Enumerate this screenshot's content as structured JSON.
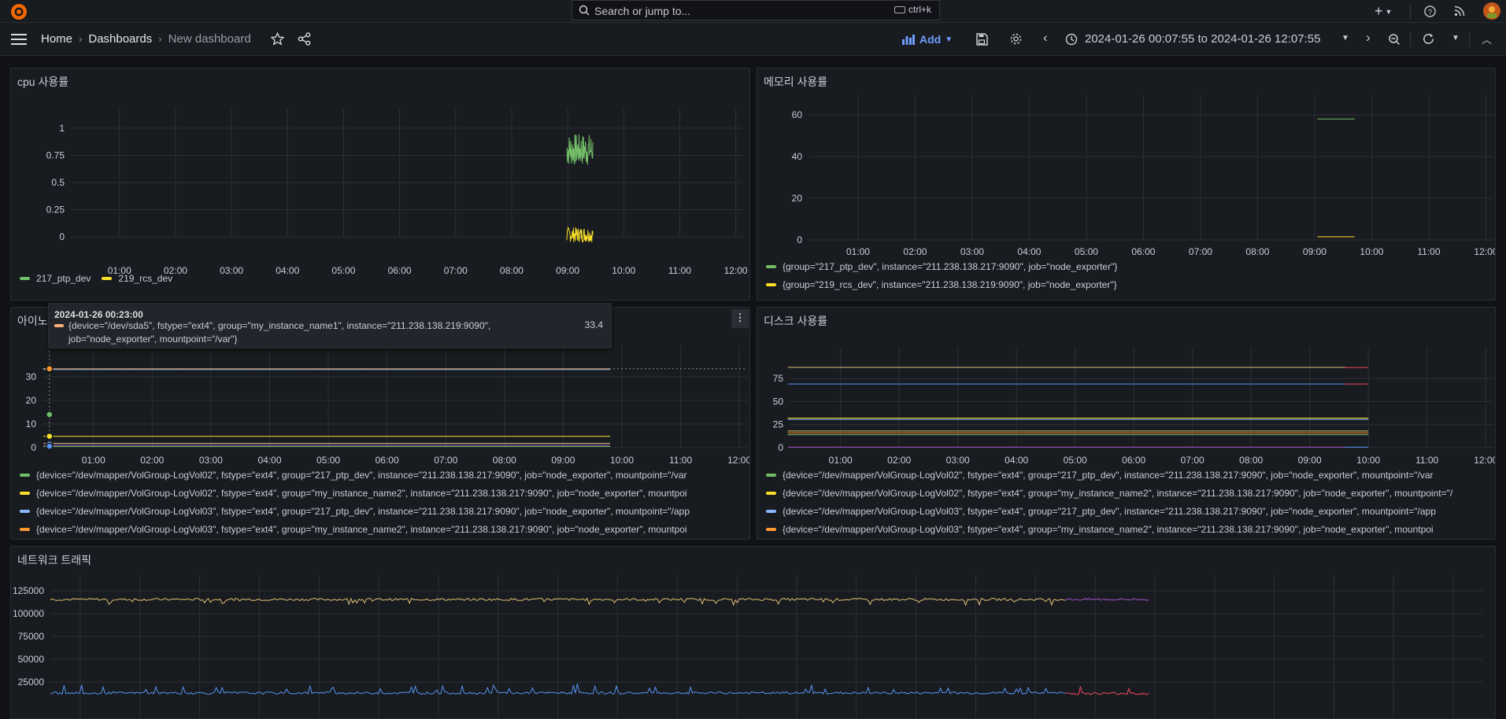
{
  "search": {
    "placeholder": "Search or jump to...",
    "shortcut": "ctrl+k"
  },
  "topbar": {
    "plus": "+",
    "icons": [
      "help-icon",
      "rss-icon",
      "avatar"
    ]
  },
  "breadcrumb": {
    "home": "Home",
    "dashboards": "Dashboards",
    "current": "New dashboard"
  },
  "toolbar": {
    "add_label": "Add",
    "time_range": "2024-01-26 00:07:55 to 2024-01-26 12:07:55"
  },
  "colors": {
    "green": "#73bf69",
    "yellow": "#fade2a",
    "blue": "#8ab8ff",
    "orange": "#ff9830",
    "purple": "#a352cc",
    "red": "#f2495c",
    "tan": "#e0c074",
    "steel": "#5794f2"
  },
  "time_ticks": [
    "01:00",
    "02:00",
    "03:00",
    "04:00",
    "05:00",
    "06:00",
    "07:00",
    "08:00",
    "09:00",
    "10:00",
    "11:00",
    "12:00"
  ],
  "panels": {
    "cpu": {
      "title": "cpu 사용률",
      "y_ticks": [
        "1",
        "0.75",
        "0.5",
        "0.25",
        "0"
      ],
      "legend": [
        "217_ptp_dev",
        "219_rcs_dev"
      ]
    },
    "memory": {
      "title": "메모리 사용률",
      "y_ticks": [
        "60",
        "40",
        "20",
        "0"
      ],
      "legend": [
        "{group=\"217_ptp_dev\", instance=\"211.238.138.217:9090\", job=\"node_exporter\"}",
        "{group=\"219_rcs_dev\", instance=\"211.238.138.219:9090\", job=\"node_exporter\"}"
      ]
    },
    "inode": {
      "title": "아이노드 사용률",
      "y_ticks": [
        "30",
        "20",
        "10",
        "0"
      ],
      "legend": [
        "{device=\"/dev/mapper/VolGroup-LogVol02\", fstype=\"ext4\", group=\"217_ptp_dev\", instance=\"211.238.138.217:9090\", job=\"node_exporter\", mountpoint=\"/var",
        "{device=\"/dev/mapper/VolGroup-LogVol02\", fstype=\"ext4\", group=\"my_instance_name2\", instance=\"211.238.138.217:9090\", job=\"node_exporter\", mountpoi",
        "{device=\"/dev/mapper/VolGroup-LogVol03\", fstype=\"ext4\", group=\"217_ptp_dev\", instance=\"211.238.138.217:9090\", job=\"node_exporter\", mountpoint=\"/app",
        "{device=\"/dev/mapper/VolGroup-LogVol03\", fstype=\"ext4\", group=\"my_instance_name2\", instance=\"211.238.138.217:9090\", job=\"node_exporter\", mountpoi"
      ],
      "tooltip": {
        "time": "2024-01-26 00:23:00",
        "label": "{device=\"/dev/sda5\", fstype=\"ext4\", group=\"my_instance_name1\", instance=\"211.238.138.219:9090\", job=\"node_exporter\", mountpoint=\"/var\"}",
        "value": "33.4"
      }
    },
    "disk": {
      "title": "디스크 사용률",
      "y_ticks": [
        "75",
        "50",
        "25",
        "0"
      ],
      "legend": [
        "{device=\"/dev/mapper/VolGroup-LogVol02\", fstype=\"ext4\", group=\"217_ptp_dev\", instance=\"211.238.138.217:9090\", job=\"node_exporter\", mountpoint=\"/var",
        "{device=\"/dev/mapper/VolGroup-LogVol02\", fstype=\"ext4\", group=\"my_instance_name2\", instance=\"211.238.138.217:9090\", job=\"node_exporter\", mountpoint=\"/",
        "{device=\"/dev/mapper/VolGroup-LogVol03\", fstype=\"ext4\", group=\"217_ptp_dev\", instance=\"211.238.138.217:9090\", job=\"node_exporter\", mountpoint=\"/app",
        "{device=\"/dev/mapper/VolGroup-LogVol03\", fstype=\"ext4\", group=\"my_instance_name2\", instance=\"211.238.138.217:9090\", job=\"node_exporter\", mountpoi"
      ]
    },
    "network": {
      "title": "네트워크 트래픽",
      "y_ticks": [
        "125000",
        "100000",
        "75000",
        "50000",
        "25000"
      ]
    }
  },
  "chart_data": [
    {
      "type": "line",
      "ylim": [
        0,
        1
      ],
      "x_range": [
        "00:07:55",
        "12:07:55"
      ],
      "series": [
        {
          "name": "217_ptp_dev",
          "x_range": [
            "08:58",
            "09:25"
          ],
          "approx_values": [
            0.7,
            0.9
          ]
        },
        {
          "name": "219_rcs_dev",
          "x_range": [
            "08:58",
            "09:25"
          ],
          "approx_values": [
            0,
            0.1
          ]
        }
      ]
    },
    {
      "type": "line",
      "ylim": [
        0,
        60
      ],
      "series": [
        {
          "name": "{group=\"217_ptp_dev\", instance=\"211.238.138.217:9090\", job=\"node_exporter\"}",
          "x_range": [
            "09:00",
            "09:35"
          ],
          "value": 58
        },
        {
          "name": "{group=\"219_rcs_dev\", instance=\"211.238.138.219:9090\", job=\"node_exporter\"}",
          "x_range": [
            "09:00",
            "09:35"
          ],
          "value": 1.5
        }
      ]
    },
    {
      "type": "line",
      "ylim": [
        0,
        35
      ],
      "levels": [
        33.4,
        4.8,
        1.8,
        0.6
      ]
    },
    {
      "type": "line",
      "ylim": [
        0,
        90
      ],
      "levels": [
        87,
        69,
        32,
        30,
        18,
        16,
        14,
        0.5
      ]
    },
    {
      "type": "line",
      "ylim": [
        0,
        130000
      ],
      "series_levels": [
        {
          "level": 115000,
          "x_range": [
            "00:07",
            "09:20"
          ]
        },
        {
          "level": 115000,
          "x_range": [
            "09:20",
            "10:10"
          ]
        },
        {
          "level": 15000,
          "x_range": [
            "00:07",
            "09:20"
          ]
        },
        {
          "level": 15000,
          "x_range": [
            "09:20",
            "10:10"
          ]
        }
      ]
    }
  ]
}
